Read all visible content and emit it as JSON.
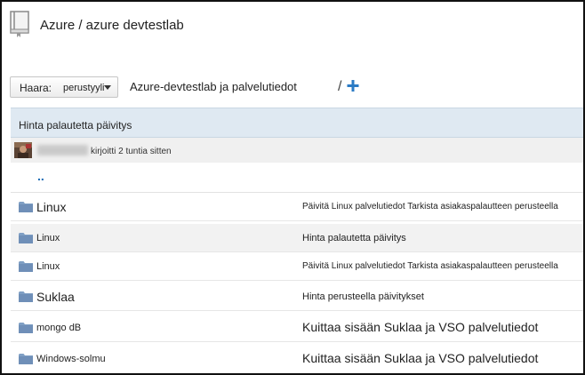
{
  "header": {
    "title": "Azure / azure devtestlab",
    "icon": "repo-book-icon"
  },
  "toolbar": {
    "branch_label": "Haara:",
    "branch_value": "perustyyli",
    "path_root": "Azure-devtestlab ja palvelutiedot",
    "path_separator": "/",
    "add_icon": "plus-icon"
  },
  "commit": {
    "message": "Hinta palautetta päivitys",
    "author": "username",
    "time": "kirjoitti 2 tuntia sitten"
  },
  "parent": {
    "label": ".."
  },
  "files": [
    {
      "name": "Linux",
      "message": "Päivitä Linux palvelutiedot Tarkista asiakaspalautteen perusteella"
    },
    {
      "name": "Linux",
      "message": "Hinta palautetta päivitys"
    },
    {
      "name": "Linux",
      "message": "Päivitä Linux palvelutiedot Tarkista asiakaspalautteen perusteella"
    },
    {
      "name": "Suklaa",
      "message": "Hinta perusteella päivitykset"
    },
    {
      "name": "mongo dB",
      "message": "Kuittaa sisään Suklaa ja VSO palvelutiedot"
    },
    {
      "name": "Windows-solmu",
      "message": "Kuittaa sisään Suklaa ja VSO palvelutiedot"
    }
  ],
  "colors": {
    "accent": "#1a6bb5",
    "folder": "#7f9fc4",
    "selected_row": "#dfe9f2"
  }
}
